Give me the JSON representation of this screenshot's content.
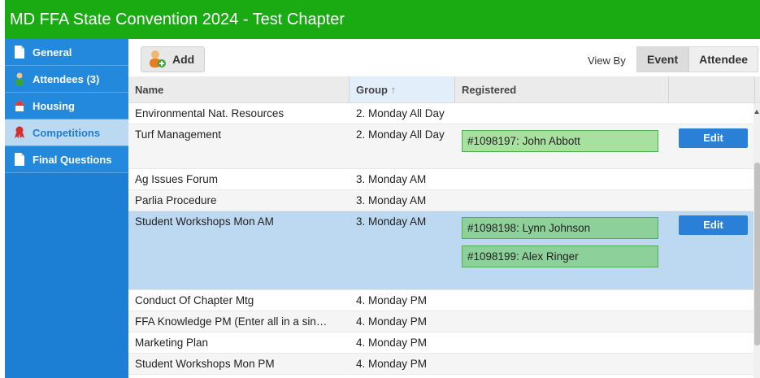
{
  "title": "MD FFA State Convention 2024 - Test Chapter",
  "sidebar": {
    "items": [
      {
        "label": "General",
        "icon": "document-icon"
      },
      {
        "label": "Attendees (3)",
        "icon": "person-icon"
      },
      {
        "label": "Housing",
        "icon": "house-icon"
      },
      {
        "label": "Competitions",
        "icon": "ribbon-icon",
        "active": true
      },
      {
        "label": "Final Questions",
        "icon": "document-icon"
      }
    ]
  },
  "toolbar": {
    "add_label": "Add",
    "viewby_label": "View By",
    "segments": [
      "Event",
      "Attendee"
    ],
    "selected_segment": "Event"
  },
  "grid": {
    "columns": [
      "Name",
      "Group",
      "Registered"
    ],
    "sort_indicator": "↑",
    "edit_label": "Edit",
    "rows": [
      {
        "name": "Environmental Nat. Resources",
        "group": "2. Monday All Day",
        "registered": []
      },
      {
        "name": "Turf Management",
        "group": "2. Monday All Day",
        "registered": [
          "#1098197: John Abbott"
        ]
      },
      {
        "name": "Ag Issues Forum",
        "group": "3. Monday AM",
        "registered": []
      },
      {
        "name": "Parlia Procedure",
        "group": "3. Monday AM",
        "registered": []
      },
      {
        "name": "Student Workshops Mon AM",
        "group": "3. Monday AM",
        "registered": [
          "#1098198: Lynn Johnson",
          "#1098199: Alex Ringer"
        ]
      },
      {
        "name": "Conduct Of Chapter Mtg",
        "group": "4. Monday PM",
        "registered": []
      },
      {
        "name": "FFA Knowledge PM (Enter all in a sin…",
        "group": "4. Monday PM",
        "registered": []
      },
      {
        "name": "Marketing Plan",
        "group": "4. Monday PM",
        "registered": []
      },
      {
        "name": "Student Workshops Mon PM",
        "group": "4. Monday PM",
        "registered": []
      }
    ]
  },
  "colors": {
    "titlebar": "#1aab12",
    "sidebar": "#1c7fd3",
    "selected_row": "#bdd8f1",
    "tag": "#a8e0a0"
  }
}
